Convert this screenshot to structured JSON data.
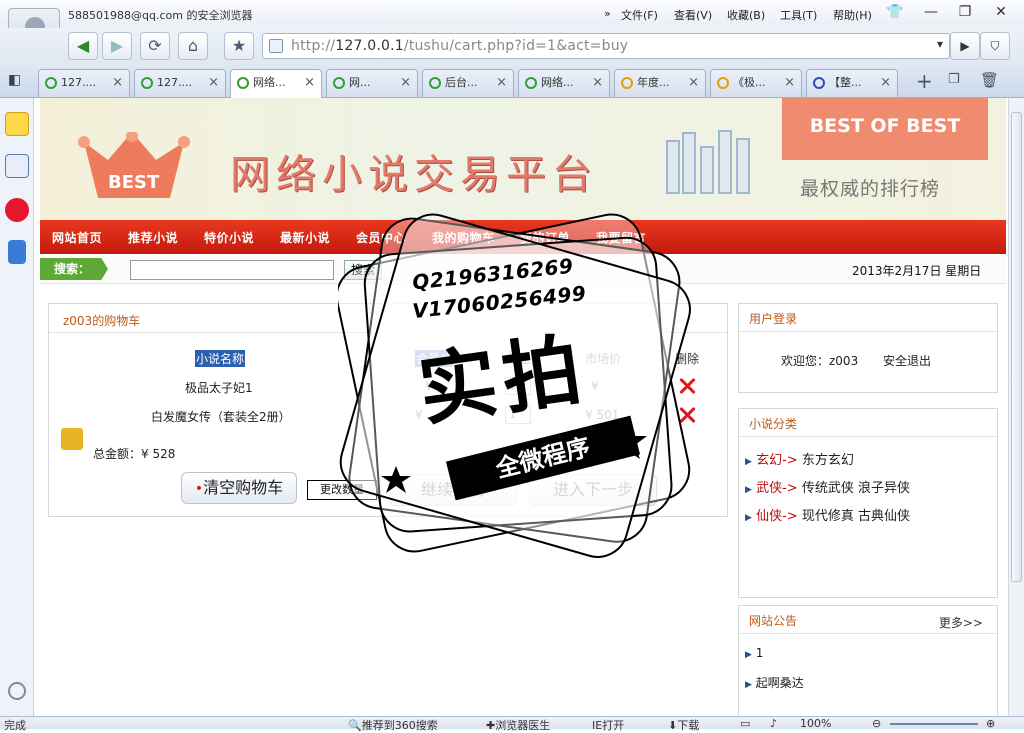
{
  "window": {
    "user_email": "588501988@qq.com 的安全浏览器",
    "menu": [
      "文件(F)",
      "查看(V)",
      "收藏(B)",
      "工具(T)",
      "帮助(H)"
    ],
    "controls": [
      "—",
      "❐",
      "✕"
    ]
  },
  "nav": {
    "url_prefix": "http://",
    "url_host": "127.0.0.1",
    "url_path": "/tushu/cart.php?id=1&act=buy"
  },
  "tabs": [
    {
      "label": "127...."
    },
    {
      "label": "127...."
    },
    {
      "label": "网络..."
    },
    {
      "label": "网..."
    },
    {
      "label": "后台..."
    },
    {
      "label": "网络..."
    },
    {
      "label": "年度..."
    },
    {
      "label": "《极..."
    },
    {
      "label": "【整..."
    }
  ],
  "site": {
    "crown_text": "BEST",
    "title": "网络小说交易平台",
    "ribbon": "BEST OF BEST",
    "tagline": "最权威的排行榜"
  },
  "menu_links": [
    "网站首页",
    "推荐小说",
    "特价小说",
    "最新小说",
    "会员中心",
    "我的购物车",
    "我的订单",
    "我要留言"
  ],
  "search": {
    "label": "搜索：",
    "button": "搜索",
    "date": "2013年2月17日 星期日"
  },
  "cart": {
    "title": "z003的购物车",
    "headers": {
      "name": "小说名称",
      "member_price": "会员价",
      "qty": "数量",
      "market_price": "市场价",
      "delete": "删除"
    },
    "rows": [
      {
        "name": "极品太子妃1",
        "member_price": "¥",
        "qty": "1",
        "market_price": "¥"
      },
      {
        "name": "白发魔女传（套装全2册）",
        "member_price": "¥",
        "qty": "1",
        "market_price": "¥ 501"
      }
    ],
    "total": "总金额：¥ 528",
    "buttons": {
      "clear": "清空购物车",
      "update": "更改数量",
      "continue": "继续购物",
      "next": "进入下一步"
    }
  },
  "login": {
    "title": "用户登录",
    "welcome": "欢迎您：z003",
    "logout": "安全退出"
  },
  "categories": {
    "title": "小说分类",
    "items": [
      {
        "name": "玄幻",
        "arrow": "->",
        "subs": "东方玄幻"
      },
      {
        "name": "武侠",
        "arrow": "->",
        "subs": "传统武侠  浪子异侠"
      },
      {
        "name": "仙侠",
        "arrow": "->",
        "subs": "现代修真  古典仙侠"
      }
    ]
  },
  "notice": {
    "title": "网站公告",
    "more": "更多>>",
    "items": [
      "1",
      "起啊桑达"
    ]
  },
  "watermark": {
    "line1": "Q2196316269",
    "line2": "V17060256499",
    "big": "实拍",
    "ribbon": "全微程序"
  },
  "status": {
    "left": "完成",
    "items": [
      "推荐到360搜索",
      "浏览器医生",
      "IE打开",
      "下载",
      "100%"
    ]
  }
}
